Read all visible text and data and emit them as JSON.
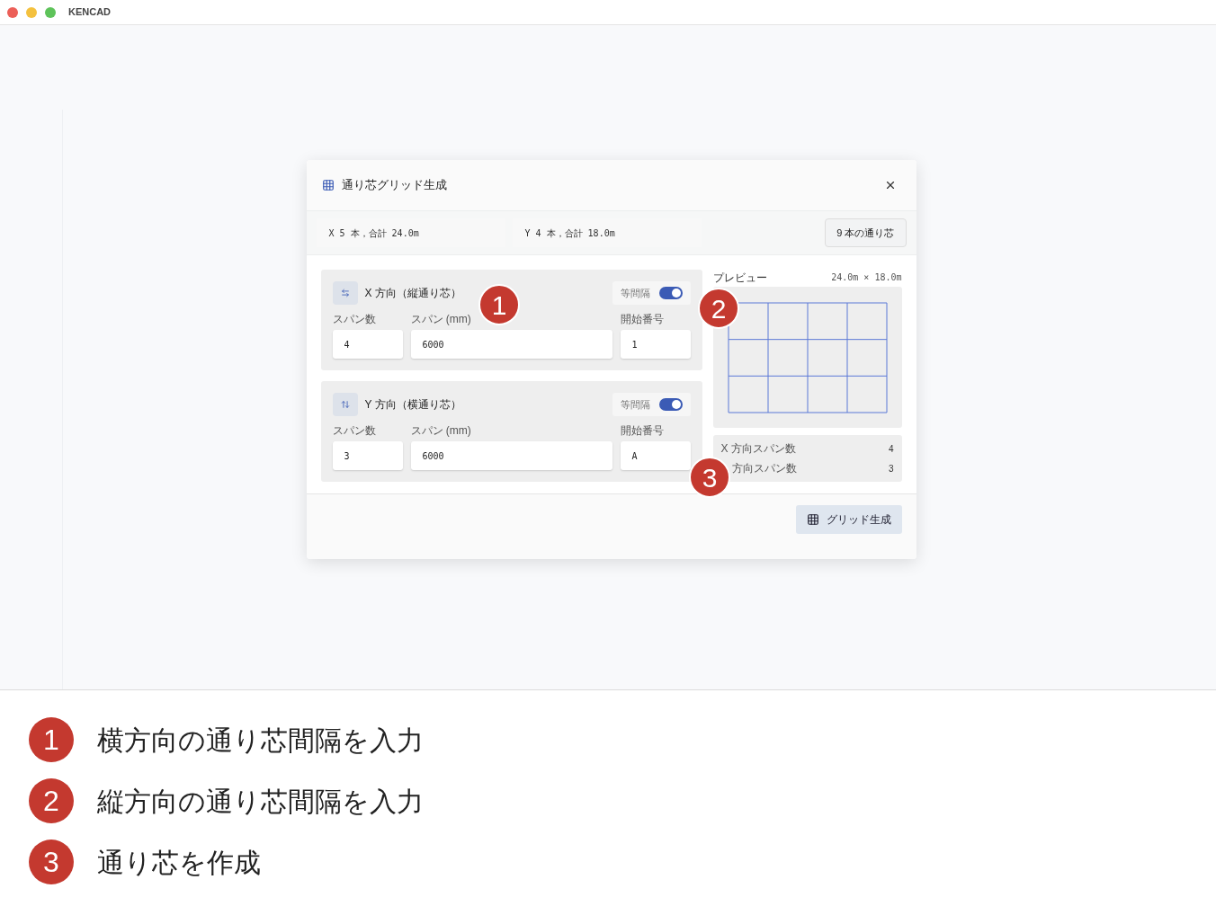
{
  "window": {
    "title": "KENCAD"
  },
  "dialog": {
    "title": "通り芯グリッド生成",
    "summary": [
      "X 5 本，合計 24.0m",
      "Y 4 本，合計 18.0m"
    ],
    "total_button": "9 本の通り芯",
    "directions": [
      {
        "kind": "x",
        "title": "X 方向（縦通り芯）",
        "equal_label": "等間隔",
        "equal_on": true,
        "fields": [
          {
            "label": "スパン数",
            "value": "4"
          },
          {
            "label": "スパン (mm)",
            "value": "6000"
          },
          {
            "label": "開始番号",
            "value": "1"
          }
        ]
      },
      {
        "kind": "y",
        "title": "Y 方向（横通り芯）",
        "equal_label": "等間隔",
        "equal_on": true,
        "fields": [
          {
            "label": "スパン数",
            "value": "3"
          },
          {
            "label": "スパン (mm)",
            "value": "6000"
          },
          {
            "label": "開始番号",
            "value": "A"
          }
        ]
      }
    ],
    "preview": {
      "label": "プレビュー",
      "size": "24.0m × 18.0m",
      "stats": [
        {
          "label": "X 方向スパン数",
          "value": "4"
        },
        {
          "label": "方向スパン数",
          "value": "3"
        }
      ]
    },
    "generate_button": "グリッド生成"
  },
  "callouts": [
    "1",
    "2",
    "3"
  ],
  "legend": [
    {
      "number": "1",
      "text": "横方向の通り芯間隔を入力"
    },
    {
      "number": "2",
      "text": "縦方向の通り芯間隔を入力"
    },
    {
      "number": "3",
      "text": "通り芯を作成"
    }
  ]
}
